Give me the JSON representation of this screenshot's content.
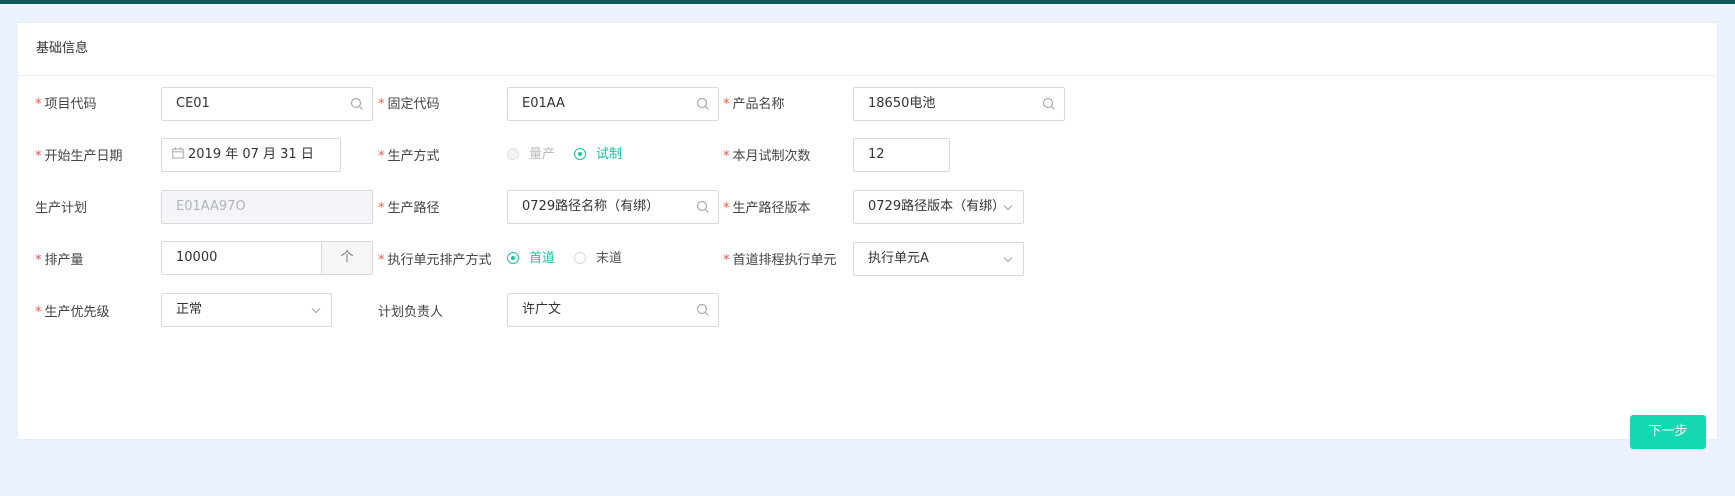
{
  "card": {
    "title": "基础信息"
  },
  "fields": {
    "project_code": {
      "label": "项目代码",
      "value": "CE01"
    },
    "fixed_code": {
      "label": "固定代码",
      "value": "E01AA"
    },
    "product_name": {
      "label": "产品名称",
      "value": "18650电池"
    },
    "start_date": {
      "label": "开始生产日期",
      "value": "2019 年 07 月 31 日"
    },
    "production_mode": {
      "label": "生产方式",
      "options": [
        "量产",
        "试制"
      ],
      "selected": "试制"
    },
    "trial_count": {
      "label": "本月试制次数",
      "value": "12"
    },
    "production_plan": {
      "label": "生产计划",
      "value": "E01AA97O"
    },
    "production_route": {
      "label": "生产路径",
      "value": "0729路径名称（有绑）"
    },
    "route_version": {
      "label": "生产路径版本",
      "value": "0729路径版本（有绑）"
    },
    "quantity": {
      "label": "排产量",
      "value": "10000",
      "stepper_symbol": "个"
    },
    "exec_mode": {
      "label": "执行单元排产方式",
      "options": [
        "首道",
        "末道"
      ],
      "selected": "首道"
    },
    "first_exec_unit": {
      "label": "首道排程执行单元",
      "value": "执行单元A"
    },
    "priority": {
      "label": "生产优先级",
      "value": "正常"
    },
    "plan_owner": {
      "label": "计划负责人",
      "value": "许广文"
    }
  },
  "required_mark": "*",
  "actions": {
    "next_label": "下一步"
  },
  "colors": {
    "accent": "#17c6a3",
    "button": "#14d8b2",
    "topbar": "#0f5a55",
    "background": "#ebf1fd"
  }
}
